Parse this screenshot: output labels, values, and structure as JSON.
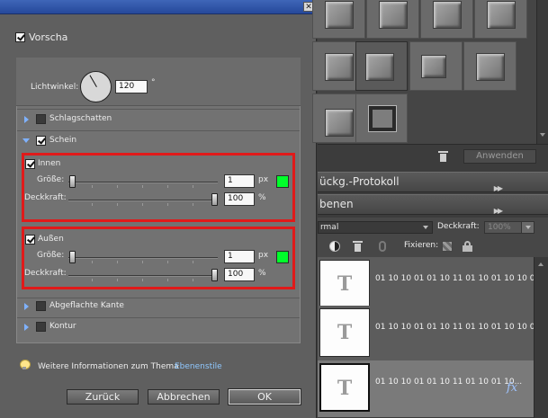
{
  "dialog": {
    "preview_label": "Vorscha",
    "light_angle_label": "Lichtwinkel:",
    "light_angle_value": "120",
    "degree_symbol": "°",
    "sections": {
      "drop_shadow": "Schlagschatten",
      "glow": "Schein",
      "bevel": "Abgeflachte Kante",
      "stroke": "Kontur"
    },
    "inner": {
      "label": "Innen",
      "size_label": "Größe:",
      "size_value": "1",
      "size_unit": "px",
      "opacity_label": "Deckkraft:",
      "opacity_value": "100",
      "opacity_unit": "%",
      "color": "#00ff2a"
    },
    "outer": {
      "label": "Außen",
      "size_label": "Größe:",
      "size_value": "1",
      "size_unit": "px",
      "opacity_label": "Deckkraft:",
      "opacity_value": "100",
      "opacity_unit": "%",
      "color": "#00ff2a"
    },
    "info_text": "Weitere Informationen zum Thema",
    "info_link": "Ebenenstile",
    "buttons": {
      "reset": "Zurück",
      "cancel": "Abbrechen",
      "ok": "OK"
    }
  },
  "right_panel": {
    "apply_button": "Anwenden",
    "history_panel": "ückg.-Protokoll",
    "layers_panel": "benen",
    "blend_mode": "rmal",
    "opacity_label": "Deckkraft:",
    "opacity_value": "100%",
    "lock_label": "Fixieren:",
    "layers": [
      {
        "thumb": "T",
        "name": "01 10 10 01 01 10 11 01 10 01 10 10 0..."
      },
      {
        "thumb": "T",
        "name": "01 10 10 01 01 10 11 01 10 01 10 10 0..."
      },
      {
        "thumb": "T",
        "name": "01 10 10 01 01 10 11 01 10 01 10..."
      }
    ],
    "fx_label": "fx"
  },
  "colors": {
    "highlight": "#e01a1a",
    "glow_color": "#00ff2a",
    "link": "#8fc8ff"
  }
}
